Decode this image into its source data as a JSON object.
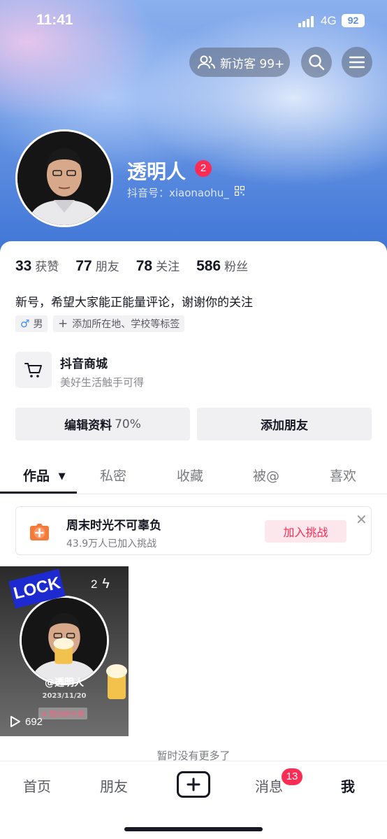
{
  "status_bar": {
    "time": "11:41",
    "network": "4G",
    "battery": "92"
  },
  "header": {
    "visitor_label": "新访客 99+",
    "username": "透明人",
    "username_badge": "2",
    "douyin_id": "抖音号：xiaonaohu_"
  },
  "stats": [
    {
      "num": "33",
      "label": "获赞"
    },
    {
      "num": "77",
      "label": "朋友"
    },
    {
      "num": "78",
      "label": "关注"
    },
    {
      "num": "586",
      "label": "粉丝"
    }
  ],
  "bio": "新号，希望大家能正能量评论，谢谢你的关注",
  "tags": {
    "gender": "男",
    "add_location": "添加所在地、学校等标签"
  },
  "shop": {
    "title": "抖音商城",
    "subtitle": "美好生活触手可得"
  },
  "buttons": {
    "edit_profile": "编辑资料",
    "edit_pct": "70%",
    "add_friend": "添加朋友"
  },
  "tabs": [
    "作品",
    "私密",
    "收藏",
    "被@",
    "喜欢"
  ],
  "challenge": {
    "title": "周末时光不可辜负",
    "subtitle": "43.9万人已加入挑战",
    "join": "加入挑战"
  },
  "video": {
    "sticker": "LOCK",
    "count": "2",
    "name": "@透明人",
    "date": "2023/11/20",
    "tag": "# 我的新头像",
    "plays": "692"
  },
  "no_more": "暂时没有更多了",
  "bottom_nav": {
    "home": "首页",
    "friends": "朋友",
    "messages": "消息",
    "messages_badge": "13",
    "me": "我"
  },
  "colors": {
    "accent": "#fe2c55",
    "header_blue": "#5f8fe0"
  }
}
